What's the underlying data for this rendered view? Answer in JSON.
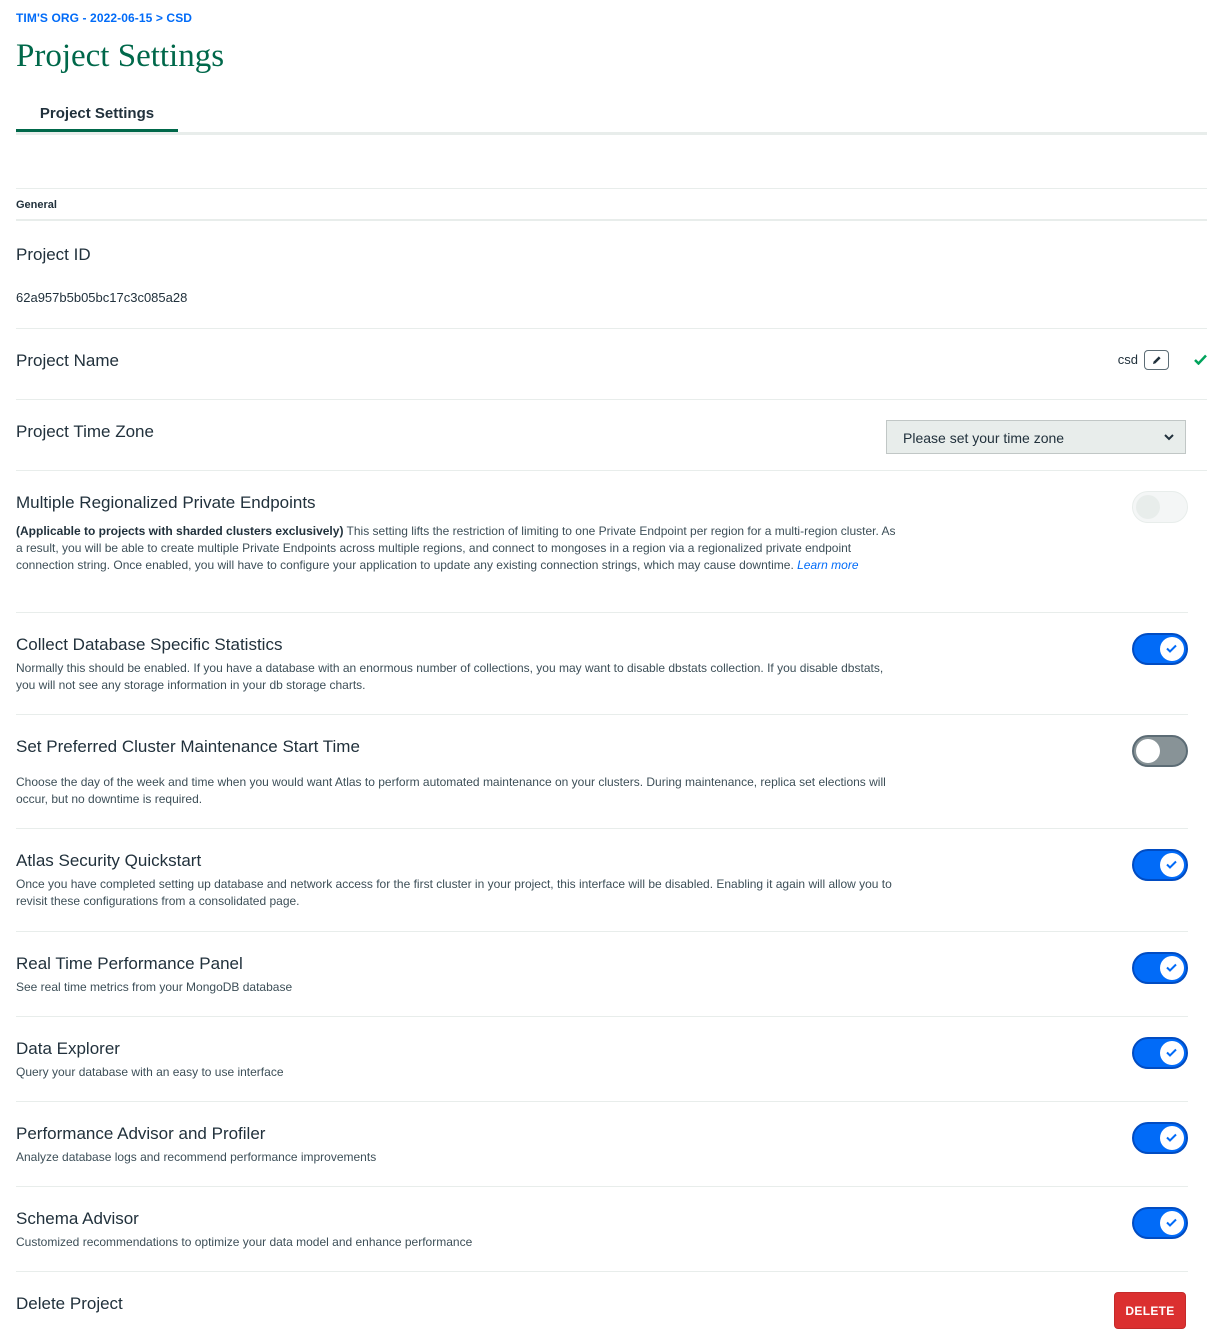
{
  "breadcrumb": {
    "org": "TIM'S ORG - 2022-06-15",
    "separator": ">",
    "project": "CSD"
  },
  "page_title": "Project Settings",
  "tabs": [
    {
      "label": "Project Settings",
      "active": true
    }
  ],
  "section": {
    "label": "General"
  },
  "project_id": {
    "title": "Project ID",
    "value": "62a957b5b05bc17c3c085a28"
  },
  "project_name": {
    "title": "Project Name",
    "value": "csd",
    "edit_icon": "pencil-icon",
    "status_icon": "checkmark-icon"
  },
  "time_zone": {
    "title": "Project Time Zone",
    "selected": "Please set your time zone"
  },
  "settings": [
    {
      "title": "Multiple Regionalized Private Endpoints",
      "desc_bold": "(Applicable to projects with sharded clusters exclusively)",
      "desc": " This setting lifts the restriction of limiting to one Private Endpoint per region for a multi-region cluster. As a result, you will be able to create multiple Private Endpoints across multiple regions, and connect to mongoses in a region via a regionalized private endpoint connection string. Once enabled, you will have to configure your application to update any existing connection strings, which may cause downtime. ",
      "link": "Learn more",
      "state": "disabled"
    },
    {
      "title": "Collect Database Specific Statistics",
      "desc": "Normally this should be enabled. If you have a database with an enormous number of collections, you may want to disable dbstats collection. If you disable dbstats, you will not see any storage information in your db storage charts.",
      "state": "on"
    },
    {
      "title": "Set Preferred Cluster Maintenance Start Time",
      "desc": "Choose the day of the week and time when you would want Atlas to perform automated maintenance on your clusters. During maintenance, replica set elections will occur, but no downtime is required.",
      "state": "off"
    },
    {
      "title": "Atlas Security Quickstart",
      "desc": "Once you have completed setting up database and network access for the first cluster in your project, this interface will be disabled. Enabling it again will allow you to revisit these configurations from a consolidated page.",
      "state": "on"
    },
    {
      "title": "Real Time Performance Panel",
      "desc": "See real time metrics from your MongoDB database",
      "state": "on"
    },
    {
      "title": "Data Explorer",
      "desc": "Query your database with an easy to use interface",
      "state": "on"
    },
    {
      "title": "Performance Advisor and Profiler",
      "desc": "Analyze database logs and recommend performance improvements",
      "state": "on"
    },
    {
      "title": "Schema Advisor",
      "desc": "Customized recommendations to optimize your data model and enhance performance",
      "state": "on"
    }
  ],
  "delete_project": {
    "title": "Delete Project",
    "button": "DELETE"
  },
  "colors": {
    "accent_green": "#00684a",
    "toggle_on": "#016bf8",
    "toggle_off": "#889397",
    "danger": "#db3030",
    "link": "#016bf8",
    "success": "#00a35c"
  }
}
